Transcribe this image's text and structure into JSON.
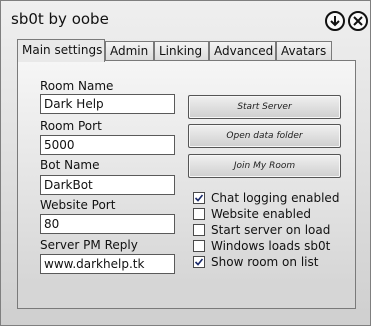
{
  "window": {
    "title": "sb0t by oobe"
  },
  "titlebar": {
    "minimize_icon": "down-arrow-circle-icon",
    "close_icon": "close-circle-icon"
  },
  "tabs": [
    {
      "label": "Main settings",
      "active": true
    },
    {
      "label": "Admin",
      "active": false
    },
    {
      "label": "Linking",
      "active": false
    },
    {
      "label": "Advanced",
      "active": false
    },
    {
      "label": "Avatars",
      "active": false
    }
  ],
  "fields": {
    "room_name": {
      "label": "Room Name",
      "value": "Dark Help"
    },
    "room_port": {
      "label": "Room Port",
      "value": "5000"
    },
    "bot_name": {
      "label": "Bot Name",
      "value": "DarkBot"
    },
    "website_port": {
      "label": "Website Port",
      "value": "80"
    },
    "server_pm_reply": {
      "label": "Server PM Reply",
      "value": "www.darkhelp.tk"
    }
  },
  "buttons": {
    "start_server": "Start Server",
    "open_data_folder": "Open data folder",
    "join_my_room": "Join My Room"
  },
  "checkboxes": [
    {
      "label": "Chat logging enabled",
      "checked": true
    },
    {
      "label": "Website enabled",
      "checked": false
    },
    {
      "label": "Start server on load",
      "checked": false
    },
    {
      "label": "Windows loads sb0t",
      "checked": false
    },
    {
      "label": "Show room on list",
      "checked": true
    }
  ]
}
